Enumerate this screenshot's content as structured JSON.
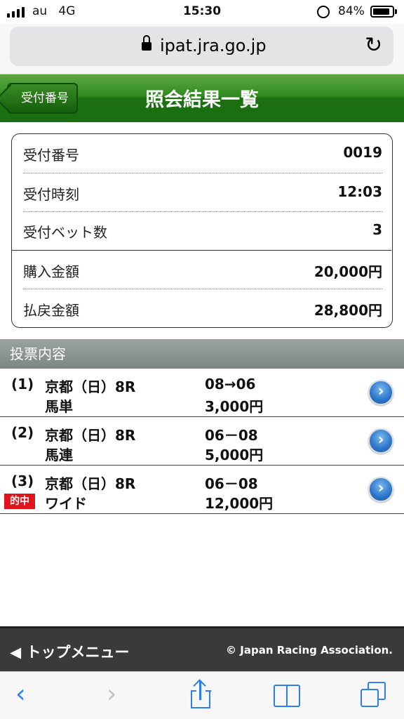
{
  "status_bar": {
    "carrier": "au",
    "network": "4G",
    "time": "15:30",
    "battery": "84%"
  },
  "url_bar": {
    "domain": "ipat.jra.go.jp"
  },
  "header": {
    "back_label": "受付番号",
    "title": "照会結果一覧"
  },
  "summary": {
    "rows": [
      {
        "label": "受付番号",
        "value": "0019"
      },
      {
        "label": "受付時刻",
        "value": "12:03"
      },
      {
        "label": "受付ベット数",
        "value": "3"
      },
      {
        "label": "購入金額",
        "value": "20,000円"
      },
      {
        "label": "払戻金額",
        "value": "28,800円"
      }
    ]
  },
  "section_title": "投票内容",
  "bets": [
    {
      "number": "(1)",
      "venue": "京都（日）8R",
      "type": "馬単",
      "combination": "08→06",
      "amount": "3,000円",
      "hit": ""
    },
    {
      "number": "(2)",
      "venue": "京都（日）8R",
      "type": "馬連",
      "combination": "06－08",
      "amount": "5,000円",
      "hit": ""
    },
    {
      "number": "(3)",
      "venue": "京都（日）8R",
      "type": "ワイド",
      "combination": "06－08",
      "amount": "12,000円",
      "hit": "的中"
    }
  ],
  "footer": {
    "top_menu": "トップメニュー",
    "copyright": "© Japan Racing Association."
  },
  "icons": {
    "reload": "reload-icon",
    "detail": "chevron-right-circle-icon",
    "back": "chevron-left-icon",
    "forward": "chevron-right-icon",
    "share": "share-icon",
    "bookmarks": "book-icon",
    "tabs": "tabs-icon"
  },
  "colors": {
    "header_green": "#1d7012",
    "section_gray": "#7c8783",
    "hit_red": "#e1141e",
    "toolbar_blue": "#2f7cf6"
  }
}
